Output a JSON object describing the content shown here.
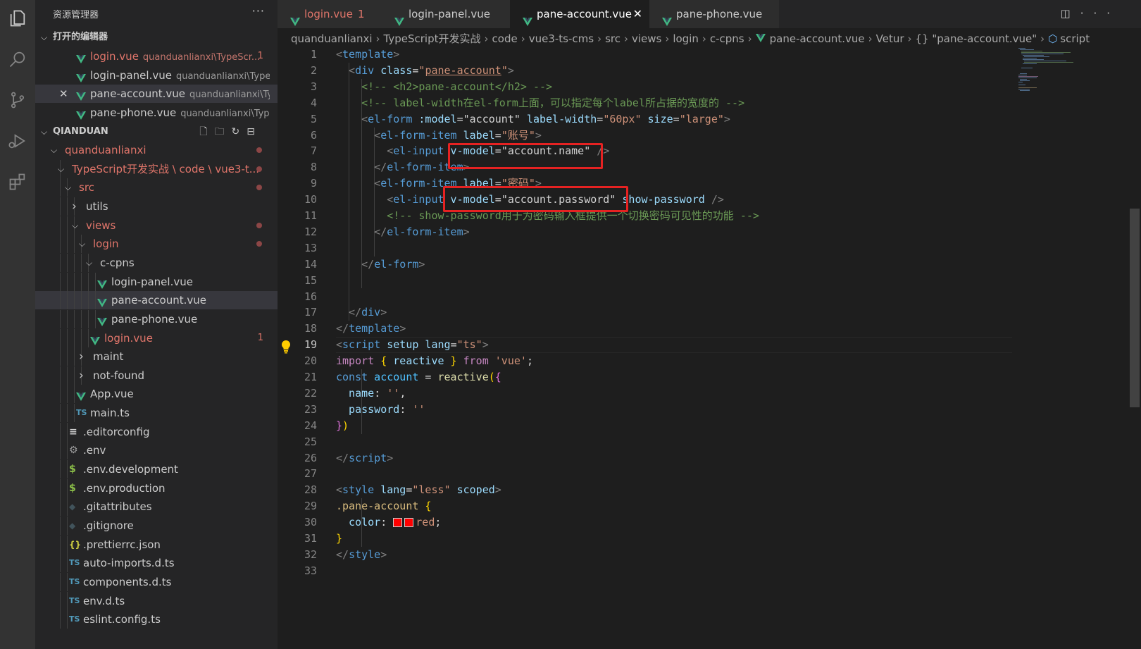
{
  "sidebar": {
    "title": "资源管理器",
    "more": "···",
    "open_editors_header": "打开的编辑器",
    "open_editors": [
      {
        "name": "login.vue",
        "path": "quanduanlianxi\\TypeScr...",
        "badge": "1",
        "modified": true
      },
      {
        "name": "login-panel.vue",
        "path": "quanduanlianxi\\TypeS...",
        "badge": "",
        "modified": false
      },
      {
        "name": "pane-account.vue",
        "path": "quanduanlianxi\\Ty...",
        "badge": "",
        "modified": false,
        "close": "✕"
      },
      {
        "name": "pane-phone.vue",
        "path": "quanduanlianxi\\Type...",
        "badge": "",
        "modified": false
      }
    ],
    "workspace_header": "QIANDUAN",
    "tree": [
      {
        "label": "quanduanlianxi",
        "kind": "folder-open",
        "color": "#e0756a",
        "dot": true
      },
      {
        "label": "TypeScript开发实战 \\ code \\ vue3-t...",
        "kind": "folder-open",
        "color": "#e0756a",
        "dot": true
      },
      {
        "label": "src",
        "kind": "folder-open",
        "color": "#e0756a",
        "dot": true
      },
      {
        "label": "utils",
        "kind": "folder-closed",
        "color": "#cccccc",
        "dot": false
      },
      {
        "label": "views",
        "kind": "folder-open",
        "color": "#e0756a",
        "dot": true
      },
      {
        "label": "login",
        "kind": "folder-open",
        "color": "#e0756a",
        "dot": true
      },
      {
        "label": "c-cpns",
        "kind": "folder-open",
        "color": "#cccccc",
        "dot": false
      },
      {
        "label": "login-panel.vue",
        "kind": "vue",
        "color": "#cccccc",
        "dot": false
      },
      {
        "label": "pane-account.vue",
        "kind": "vue",
        "color": "#cccccc",
        "dot": false
      },
      {
        "label": "pane-phone.vue",
        "kind": "vue",
        "color": "#cccccc",
        "dot": false
      },
      {
        "label": "login.vue",
        "kind": "vue",
        "color": "#e0756a",
        "badge": "1"
      },
      {
        "label": "maint",
        "kind": "folder-closed",
        "color": "#cccccc",
        "dot": false
      },
      {
        "label": "not-found",
        "kind": "folder-closed",
        "color": "#cccccc",
        "dot": false
      },
      {
        "label": "App.vue",
        "kind": "vue",
        "color": "#cccccc",
        "dot": false
      },
      {
        "label": "main.ts",
        "kind": "ts",
        "color": "#cccccc",
        "dot": false
      },
      {
        "label": ".editorconfig",
        "kind": "lines",
        "color": "#cccccc",
        "dot": false
      },
      {
        "label": ".env",
        "kind": "gear",
        "color": "#cccccc",
        "dot": false
      },
      {
        "label": ".env.development",
        "kind": "dollar",
        "color": "#cccccc",
        "dot": false
      },
      {
        "label": ".env.production",
        "kind": "dollar",
        "color": "#cccccc",
        "dot": false
      },
      {
        "label": ".gitattributes",
        "kind": "git",
        "color": "#cccccc",
        "dot": false
      },
      {
        "label": ".gitignore",
        "kind": "git",
        "color": "#cccccc",
        "dot": false
      },
      {
        "label": ".prettierrc.json",
        "kind": "json",
        "color": "#cccccc",
        "dot": false
      },
      {
        "label": "auto-imports.d.ts",
        "kind": "ts",
        "color": "#cccccc",
        "dot": false
      },
      {
        "label": "components.d.ts",
        "kind": "ts",
        "color": "#cccccc",
        "dot": false
      },
      {
        "label": "env.d.ts",
        "kind": "ts",
        "color": "#cccccc",
        "dot": false
      },
      {
        "label": "eslint.config.ts",
        "kind": "ts",
        "color": "#cccccc",
        "dot": false
      }
    ]
  },
  "tabs": [
    {
      "label": "login.vue",
      "badge": "1",
      "color": "#e0756a",
      "active": false
    },
    {
      "label": "login-panel.vue",
      "badge": "",
      "color": "#cccccc",
      "active": false
    },
    {
      "label": "pane-account.vue",
      "badge": "",
      "color": "#ffffff",
      "active": true,
      "close": "✕"
    },
    {
      "label": "pane-phone.vue",
      "badge": "",
      "color": "#cccccc",
      "active": false
    }
  ],
  "breadcrumb": [
    "quanduanlianxi",
    "TypeScript开发实战",
    "code",
    "vue3-ts-cms",
    "src",
    "views",
    "login",
    "c-cpns",
    "pane-account.vue",
    "Vetur",
    "{} \"pane-account.vue\"",
    "script"
  ],
  "editor": {
    "current_line": 19,
    "lines": [
      [
        {
          "t": "<",
          "c": "#808080"
        },
        {
          "t": "template",
          "c": "#569cd6"
        },
        {
          "t": ">",
          "c": "#808080"
        }
      ],
      [
        {
          "t": "  <",
          "c": "#808080"
        },
        {
          "t": "div",
          "c": "#569cd6"
        },
        {
          "t": " class",
          "c": "#9cdcfe"
        },
        {
          "t": "=",
          "c": "#d4d4d4"
        },
        {
          "t": "\"",
          "c": "#ce9178"
        },
        {
          "t": "pane-account",
          "c": "#ce9178",
          "u": true
        },
        {
          "t": "\"",
          "c": "#ce9178"
        },
        {
          "t": ">",
          "c": "#808080"
        }
      ],
      [
        {
          "t": "    <!-- <h2>pane-account</h2> -->",
          "c": "#6a9955"
        }
      ],
      [
        {
          "t": "    <!-- label-width在el-form上面，可以指定每个label所占据的宽度的 -->",
          "c": "#6a9955"
        }
      ],
      [
        {
          "t": "    <",
          "c": "#808080"
        },
        {
          "t": "el-form",
          "c": "#569cd6"
        },
        {
          "t": " :model",
          "c": "#9cdcfe"
        },
        {
          "t": "=",
          "c": "#d4d4d4"
        },
        {
          "t": "\"account\"",
          "c": "#d4d4d4"
        },
        {
          "t": " label-width",
          "c": "#9cdcfe"
        },
        {
          "t": "=",
          "c": "#d4d4d4"
        },
        {
          "t": "\"60px\"",
          "c": "#ce9178"
        },
        {
          "t": " size",
          "c": "#9cdcfe"
        },
        {
          "t": "=",
          "c": "#d4d4d4"
        },
        {
          "t": "\"large\"",
          "c": "#ce9178"
        },
        {
          "t": ">",
          "c": "#808080"
        }
      ],
      [
        {
          "t": "      <",
          "c": "#808080"
        },
        {
          "t": "el-form-item",
          "c": "#569cd6"
        },
        {
          "t": " label",
          "c": "#9cdcfe"
        },
        {
          "t": "=",
          "c": "#d4d4d4"
        },
        {
          "t": "\"账号\"",
          "c": "#ce9178"
        },
        {
          "t": ">",
          "c": "#808080"
        }
      ],
      [
        {
          "t": "        <",
          "c": "#808080"
        },
        {
          "t": "el-input",
          "c": "#569cd6"
        },
        {
          "t": " v-model",
          "c": "#9cdcfe"
        },
        {
          "t": "=",
          "c": "#d4d4d4"
        },
        {
          "t": "\"account.name\"",
          "c": "#d4d4d4"
        },
        {
          "t": " />",
          "c": "#808080"
        }
      ],
      [
        {
          "t": "      </",
          "c": "#808080"
        },
        {
          "t": "el-form-item",
          "c": "#569cd6"
        },
        {
          "t": ">",
          "c": "#808080"
        }
      ],
      [
        {
          "t": "      <",
          "c": "#808080"
        },
        {
          "t": "el-form-item",
          "c": "#569cd6"
        },
        {
          "t": " label",
          "c": "#9cdcfe"
        },
        {
          "t": "=",
          "c": "#d4d4d4"
        },
        {
          "t": "\"密码\"",
          "c": "#ce9178"
        },
        {
          "t": ">",
          "c": "#808080"
        }
      ],
      [
        {
          "t": "        <",
          "c": "#808080"
        },
        {
          "t": "el-input",
          "c": "#569cd6"
        },
        {
          "t": " v-model",
          "c": "#9cdcfe"
        },
        {
          "t": "=",
          "c": "#d4d4d4"
        },
        {
          "t": "\"account.password\"",
          "c": "#d4d4d4"
        },
        {
          "t": " show-password",
          "c": "#9cdcfe"
        },
        {
          "t": " />",
          "c": "#808080"
        }
      ],
      [
        {
          "t": "        <!-- show-password用于为密码输入框提供一个切换密码可见性的功能 -->",
          "c": "#6a9955"
        }
      ],
      [
        {
          "t": "      </",
          "c": "#808080"
        },
        {
          "t": "el-form-item",
          "c": "#569cd6"
        },
        {
          "t": ">",
          "c": "#808080"
        }
      ],
      [
        {
          "t": "",
          "c": "#d4d4d4"
        }
      ],
      [
        {
          "t": "    </",
          "c": "#808080"
        },
        {
          "t": "el-form",
          "c": "#569cd6"
        },
        {
          "t": ">",
          "c": "#808080"
        }
      ],
      [
        {
          "t": "",
          "c": "#d4d4d4"
        }
      ],
      [
        {
          "t": "",
          "c": "#d4d4d4"
        }
      ],
      [
        {
          "t": "  </",
          "c": "#808080"
        },
        {
          "t": "div",
          "c": "#569cd6"
        },
        {
          "t": ">",
          "c": "#808080"
        }
      ],
      [
        {
          "t": "</",
          "c": "#808080"
        },
        {
          "t": "template",
          "c": "#569cd6"
        },
        {
          "t": ">",
          "c": "#808080"
        }
      ],
      [
        {
          "t": "<",
          "c": "#808080"
        },
        {
          "t": "script",
          "c": "#569cd6"
        },
        {
          "t": " setup",
          "c": "#9cdcfe"
        },
        {
          "t": " lang",
          "c": "#9cdcfe"
        },
        {
          "t": "=",
          "c": "#d4d4d4"
        },
        {
          "t": "\"ts\"",
          "c": "#ce9178"
        },
        {
          "t": ">",
          "c": "#808080"
        }
      ],
      [
        {
          "t": "import",
          "c": "#c586c0"
        },
        {
          "t": " { ",
          "c": "#ffd700"
        },
        {
          "t": "reactive",
          "c": "#9cdcfe"
        },
        {
          "t": " } ",
          "c": "#ffd700"
        },
        {
          "t": "from",
          "c": "#c586c0"
        },
        {
          "t": " 'vue'",
          "c": "#ce9178"
        },
        {
          "t": ";",
          "c": "#d4d4d4"
        }
      ],
      [
        {
          "t": "const",
          "c": "#569cd6"
        },
        {
          "t": " account",
          "c": "#4fc1ff"
        },
        {
          "t": " = ",
          "c": "#d4d4d4"
        },
        {
          "t": "reactive",
          "c": "#dcdcaa"
        },
        {
          "t": "(",
          "c": "#ffd700"
        },
        {
          "t": "{",
          "c": "#da70d6"
        }
      ],
      [
        {
          "t": "  name",
          "c": "#9cdcfe"
        },
        {
          "t": ": ",
          "c": "#d4d4d4"
        },
        {
          "t": "''",
          "c": "#ce9178"
        },
        {
          "t": ",",
          "c": "#d4d4d4"
        }
      ],
      [
        {
          "t": "  password",
          "c": "#9cdcfe"
        },
        {
          "t": ": ",
          "c": "#d4d4d4"
        },
        {
          "t": "''",
          "c": "#ce9178"
        }
      ],
      [
        {
          "t": "}",
          "c": "#da70d6"
        },
        {
          "t": ")",
          "c": "#ffd700"
        }
      ],
      [
        {
          "t": "",
          "c": "#d4d4d4"
        }
      ],
      [
        {
          "t": "</",
          "c": "#808080"
        },
        {
          "t": "script",
          "c": "#569cd6"
        },
        {
          "t": ">",
          "c": "#808080"
        }
      ],
      [
        {
          "t": "",
          "c": "#d4d4d4"
        }
      ],
      [
        {
          "t": "<",
          "c": "#808080"
        },
        {
          "t": "style",
          "c": "#569cd6"
        },
        {
          "t": " lang",
          "c": "#9cdcfe"
        },
        {
          "t": "=",
          "c": "#d4d4d4"
        },
        {
          "t": "\"less\"",
          "c": "#ce9178"
        },
        {
          "t": " scoped",
          "c": "#9cdcfe"
        },
        {
          "t": ">",
          "c": "#808080"
        }
      ],
      [
        {
          "t": ".pane-account",
          "c": "#d7ba7d"
        },
        {
          "t": " {",
          "c": "#ffd700"
        }
      ],
      [
        {
          "t": "  color",
          "c": "#9cdcfe"
        },
        {
          "t": ": ",
          "c": "#d4d4d4"
        },
        {
          "swatch": true
        },
        {
          "t": "red",
          "c": "#ce9178"
        },
        {
          "t": ";",
          "c": "#d4d4d4"
        }
      ],
      [
        {
          "t": "}",
          "c": "#ffd700"
        }
      ],
      [
        {
          "t": "</",
          "c": "#808080"
        },
        {
          "t": "style",
          "c": "#569cd6"
        },
        {
          "t": ">",
          "c": "#808080"
        }
      ],
      [
        {
          "t": "",
          "c": "#d4d4d4"
        }
      ]
    ]
  },
  "colors": {
    "accent": "#e0756a",
    "vue_green": "#41b883",
    "highlight_red": "#e52222"
  }
}
